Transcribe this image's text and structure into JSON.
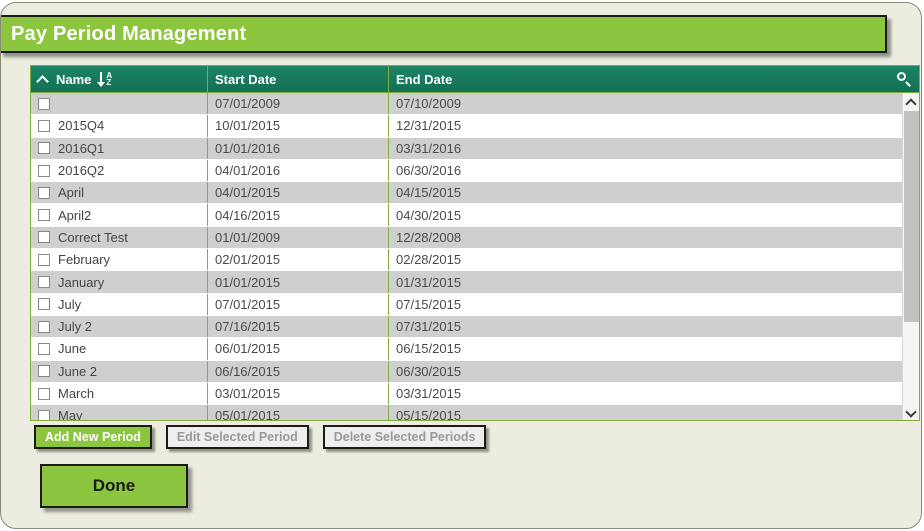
{
  "window": {
    "title": "Pay Period Management"
  },
  "grid": {
    "columns": [
      {
        "key": "name",
        "label": "Name",
        "sort_icon": "sort-descending-az-icon"
      },
      {
        "key": "start",
        "label": "Start Date"
      },
      {
        "key": "end",
        "label": "End Date"
      }
    ],
    "collapse_icon": "chevron-up-icon",
    "search_icon": "search-icon",
    "rows": [
      {
        "name": "",
        "start": "07/01/2009",
        "end": "07/10/2009",
        "checked": false
      },
      {
        "name": "2015Q4",
        "start": "10/01/2015",
        "end": "12/31/2015",
        "checked": false
      },
      {
        "name": "2016Q1",
        "start": "01/01/2016",
        "end": "03/31/2016",
        "checked": false
      },
      {
        "name": "2016Q2",
        "start": "04/01/2016",
        "end": "06/30/2016",
        "checked": false
      },
      {
        "name": "April",
        "start": "04/01/2015",
        "end": "04/15/2015",
        "checked": false
      },
      {
        "name": "April2",
        "start": "04/16/2015",
        "end": "04/30/2015",
        "checked": false
      },
      {
        "name": "Correct Test",
        "start": "01/01/2009",
        "end": "12/28/2008",
        "checked": false
      },
      {
        "name": "February",
        "start": "02/01/2015",
        "end": "02/28/2015",
        "checked": false
      },
      {
        "name": "January",
        "start": "01/01/2015",
        "end": "01/31/2015",
        "checked": false
      },
      {
        "name": "July",
        "start": "07/01/2015",
        "end": "07/15/2015",
        "checked": false
      },
      {
        "name": "July 2",
        "start": "07/16/2015",
        "end": "07/31/2015",
        "checked": false
      },
      {
        "name": "June",
        "start": "06/01/2015",
        "end": "06/15/2015",
        "checked": false
      },
      {
        "name": "June 2",
        "start": "06/16/2015",
        "end": "06/30/2015",
        "checked": false
      },
      {
        "name": "March",
        "start": "03/01/2015",
        "end": "03/31/2015",
        "checked": false
      },
      {
        "name": "May",
        "start": "05/01/2015",
        "end": "05/15/2015",
        "checked": false
      }
    ],
    "scrollbar": {
      "up_icon": "chevron-up-icon",
      "down_icon": "chevron-down-icon"
    }
  },
  "actions": {
    "add": {
      "label": "Add New Period",
      "enabled": true
    },
    "edit": {
      "label": "Edit Selected Period",
      "enabled": false
    },
    "delete": {
      "label": "Delete Selected Periods",
      "enabled": false
    }
  },
  "footer": {
    "done_label": "Done"
  },
  "colors": {
    "brand_green": "#8cc63e",
    "header_teal": "#127055",
    "page_bg": "#edece0",
    "row_alt": "#cfcfcf",
    "grid_border": "#7fae3a"
  }
}
